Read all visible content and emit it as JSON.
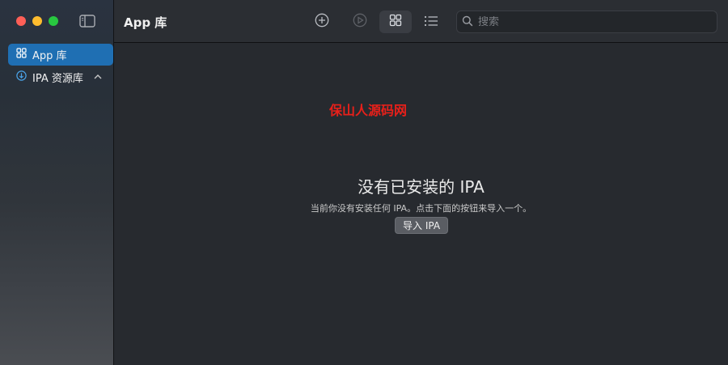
{
  "sidebar": {
    "items": [
      {
        "label": "App 库",
        "icon": "grid-icon"
      },
      {
        "label": "IPA 资源库",
        "icon": "download-circle-icon"
      }
    ]
  },
  "toolbar": {
    "title": "App 库",
    "buttons": [
      "add-icon",
      "play-icon",
      "grid-view-icon",
      "list-view-icon"
    ]
  },
  "search": {
    "placeholder": "搜索"
  },
  "main": {
    "watermark": "保山人源码网",
    "empty_title": "没有已安装的 IPA",
    "empty_subtitle": "当前你没有安装任何 IPA。点击下面的按钮来导入一个。",
    "import_button": "导入 IPA"
  },
  "colors": {
    "accent": "#1f6fb3",
    "watermark": "#e8201a",
    "close": "#fe5f57",
    "minimize": "#febc2e",
    "maximize": "#28c840"
  }
}
